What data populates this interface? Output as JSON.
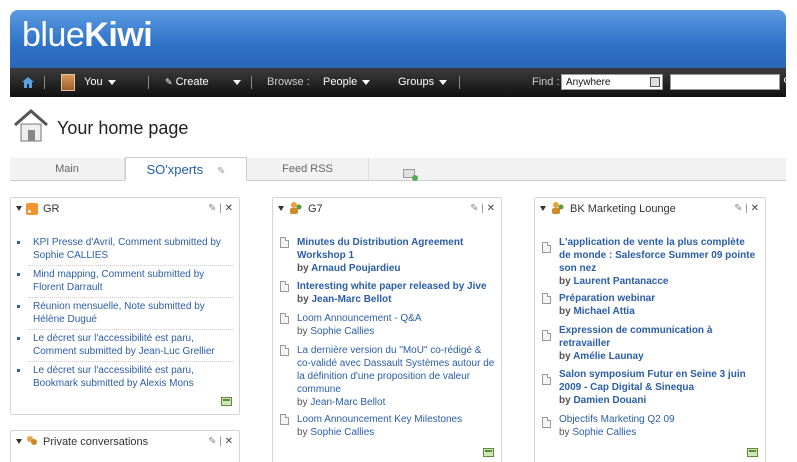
{
  "app": {
    "logo_light": "blue",
    "logo_bold": "Kiwi"
  },
  "nav": {
    "you": "You",
    "create": "Create",
    "browse": "Browse :",
    "people": "People",
    "groups": "Groups",
    "find": "Find :",
    "find_scope": "Anywhere",
    "search_value": ""
  },
  "page": {
    "title": "Your home page"
  },
  "tabs": [
    {
      "label": "Main"
    },
    {
      "label": "SO'xperts",
      "active": true
    },
    {
      "label": "Feed RSS"
    }
  ],
  "widgets": {
    "gr": {
      "title": "GR",
      "items": [
        {
          "text": "KPI Presse d'Avril, Comment submitted by Sophie CALLIES"
        },
        {
          "text": "Mind mapping, Comment submitted by Florent Darrault"
        },
        {
          "text": "Réunion mensuelle, Note submitted by Hélène Dugué"
        },
        {
          "text": "Le décret sur l'accessibilité est paru, Comment submitted by Jean-Luc Grellier"
        },
        {
          "text": "Le décret sur l'accessibilité est paru, Bookmark submitted by Alexis Mons"
        }
      ]
    },
    "private": {
      "title": "Private conversations"
    },
    "g7": {
      "title": "G7",
      "items": [
        {
          "title": "Minutes du Distribution Agreement Workshop 1",
          "by": "by ",
          "author": "Arnaud Poujardieu",
          "bold": true
        },
        {
          "title": "Interesting white paper released by Jive",
          "by": "by ",
          "author": "Jean-Marc Bellot",
          "bold": true
        },
        {
          "title": "Loom Announcement - Q&A",
          "by": "by ",
          "author": "Sophie Callies",
          "bold": false
        },
        {
          "title": "La dernière version du \"MoU\" co-rédigé & co-validé avec Dassault Systèmes autour de la définition d'une proposition de valeur commune",
          "by": "by ",
          "author": "Jean-Marc Bellot",
          "bold": false
        },
        {
          "title": "Loom Announcement Key Milestones",
          "by": "by ",
          "author": "Sophie Callies",
          "bold": false
        }
      ]
    },
    "bk": {
      "title": "BK Marketing Lounge",
      "items": [
        {
          "title": "L'application de vente la plus complète de monde : Salesforce Summer 09 pointe son nez",
          "by": "by ",
          "author": "Laurent Pantanacce",
          "bold": true
        },
        {
          "title": "Préparation webinar",
          "by": "by ",
          "author": "Michael Attia",
          "bold": true
        },
        {
          "title": "Expression de communication à retravailler",
          "by": "by ",
          "author": "Amélie Launay",
          "bold": true
        },
        {
          "title": "Salon symposium Futur en Seine 3 juin 2009 - Cap Digital & Sinequa",
          "by": "by ",
          "author": "Damien Douani",
          "bold": true
        },
        {
          "title": "Objectifs Marketing Q2 09",
          "by": "by ",
          "author": "Sophie Callies",
          "bold": false
        }
      ]
    }
  }
}
